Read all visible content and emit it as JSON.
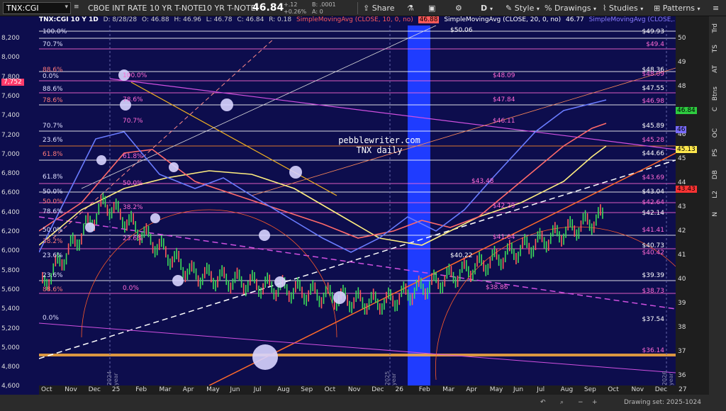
{
  "toolbar": {
    "symbol": "TNX:CGI",
    "name": "CBOE INT RATE 10 YR T-NOTE",
    "short_name": "10 YR T-NOTE",
    "price": "46.84",
    "change": "+.12",
    "change_pct": "+0.26%",
    "bid_size": "B: .0001",
    "ask_size": "A: 0",
    "share_label": "Share",
    "period_label": "D",
    "style_label": "Style",
    "drawings_label": "Drawings",
    "studies_label": "Studies",
    "patterns_label": "Patterns"
  },
  "chart_head": {
    "symbol": "TNX:CGI 10 Y 1D",
    "date": "D: 8/28/28",
    "open": "O: 46.88",
    "high": "H: 46.96",
    "low": "L: 46.78",
    "close": "C: 46.84",
    "range": "R: 0.18",
    "sma10": "SimpleMovingAvg (CLOSE, 10, 0, no)",
    "sma10_val": "46.88",
    "sma20": "SimpleMovingAvg (CLOSE, 20, 0, no)",
    "sma20_val": "46.77",
    "sma50": "SimpleMovingAvg (CLOSE,...",
    "top_label": "$50.06"
  },
  "watermark": {
    "line1": "pebblewriter.com",
    "line2": "TNX daily"
  },
  "left_axis": [
    "8,200",
    "8,000",
    "7,800",
    "7,600",
    "7,400",
    "7,200",
    "7,000",
    "6,800",
    "6,600",
    "6,400",
    "6,200",
    "6,000",
    "5,800",
    "5,600",
    "5,400",
    "5,200",
    "5,000",
    "4,800",
    "4,600"
  ],
  "left_marker": "7,752",
  "right_axis": [
    "50",
    "49",
    "48",
    "47",
    "46",
    "45",
    "44",
    "43",
    "42",
    "41",
    "40",
    "39",
    "38",
    "37",
    "36",
    "35"
  ],
  "right_tags": [
    {
      "text": "46.84",
      "bg": "#2ecc40"
    },
    {
      "text": "46",
      "bg": "#7a6cff"
    },
    {
      "text": "45.13",
      "bg": "#ffe84d"
    },
    {
      "text": "43.43",
      "bg": "#ff3333"
    }
  ],
  "fib_left": [
    "100.0%",
    "70.7%",
    "88.6%",
    "0.0%",
    "88.6%",
    "78.6%",
    "70.7%",
    "23.6%",
    "61.8%",
    "61.8%",
    "50.0%",
    "50.0%",
    "78.6%",
    "50.0%",
    "38.2%",
    "23.6%",
    "23.6%",
    "88.6%",
    "0.0%"
  ],
  "fib_right": [
    "$49.93",
    "$49.4",
    "$48.36",
    "$48.09",
    "$47.55",
    "$46.98",
    "$45.89",
    "$45.28",
    "$44.66",
    "$43.69",
    "$43.04",
    "$42.64",
    "$42.14",
    "$41.41",
    "$40.73",
    "$40.42",
    "$39.39",
    "$38.73",
    "$37.54",
    "$36.14"
  ],
  "mid_labels": [
    "$48.09",
    "$47.84",
    "$46.11",
    "$43.48",
    "$42.29",
    "$41.04",
    "$40.22",
    "$38.86"
  ],
  "pct_mid": [
    "100.0%",
    "78.6%",
    "70.7%",
    "61.8%",
    "50.0%",
    "38.2%",
    "23.6%",
    "0.0%"
  ],
  "xaxis": [
    "Oct",
    "Nov",
    "Dec",
    "25",
    "Feb",
    "Mar",
    "Apr",
    "May",
    "Jun",
    "Jul",
    "Aug",
    "Sep",
    "Oct",
    "Nov",
    "Dec",
    "26",
    "Feb",
    "Mar",
    "Apr",
    "May",
    "Jun",
    "Jul",
    "Aug",
    "Sep",
    "Oct",
    "Nov",
    "Dec",
    "27"
  ],
  "year_marks": [
    "2024 year",
    "2025 year",
    "2026 year"
  ],
  "sidebar": [
    "Trd",
    "TS",
    "AT",
    "Btns",
    "C",
    "OC",
    "PS",
    "DB",
    "L2",
    "N"
  ],
  "status": {
    "drawing_set": "Drawing set: 2025-1024"
  },
  "colors": {
    "bg": "#0d0d4d",
    "highlight": "#1f3cff",
    "magenta": "#d040d0",
    "orange": "#ff6a2a",
    "yellow": "#e8d36a",
    "blue": "#6a7cff"
  }
}
